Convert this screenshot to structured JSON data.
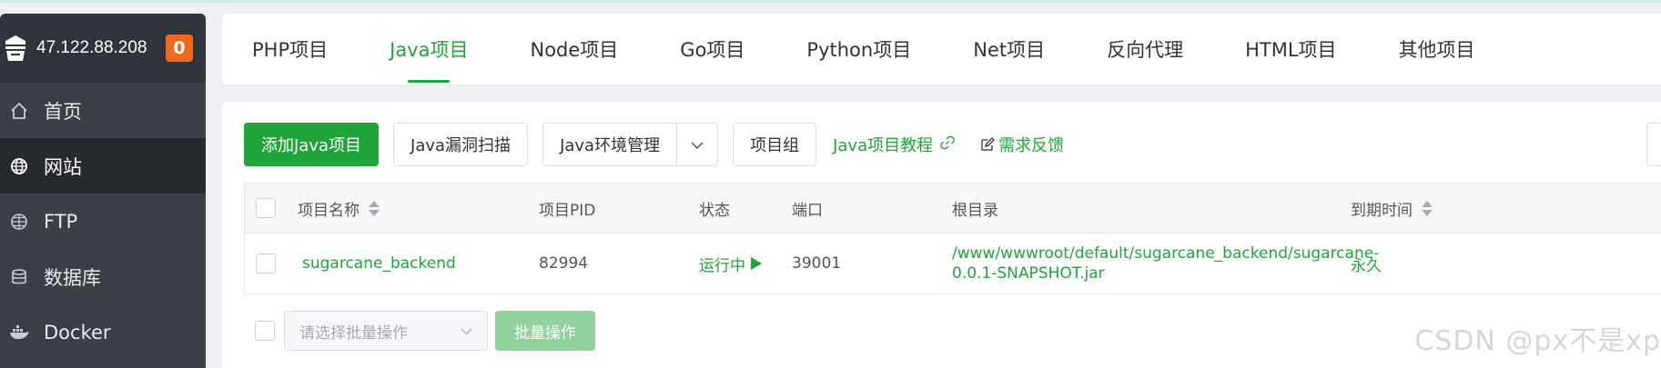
{
  "sidebar": {
    "server_ip": "47.122.88.208",
    "notice_count": "0",
    "items": [
      {
        "label": "首页",
        "icon": "home-icon"
      },
      {
        "label": "网站",
        "icon": "globe-icon"
      },
      {
        "label": "FTP",
        "icon": "ftp-globe-icon"
      },
      {
        "label": "数据库",
        "icon": "database-icon"
      },
      {
        "label": "Docker",
        "icon": "docker-icon"
      }
    ]
  },
  "tabs": [
    {
      "label": "PHP项目"
    },
    {
      "label": "Java项目"
    },
    {
      "label": "Node项目"
    },
    {
      "label": "Go项目"
    },
    {
      "label": "Python项目"
    },
    {
      "label": "Net项目"
    },
    {
      "label": "反向代理"
    },
    {
      "label": "HTML项目"
    },
    {
      "label": "其他项目"
    }
  ],
  "active_tab": "Java项目",
  "toolbar": {
    "add_label": "添加Java项目",
    "scan_label": "Java漏洞扫描",
    "env_label": "Java环境管理",
    "group_label": "项目组",
    "tutorial_label": "Java项目教程",
    "feedback_label": "需求反馈"
  },
  "table": {
    "columns": {
      "name": "项目名称",
      "pid": "项目PID",
      "status": "状态",
      "port": "端口",
      "root": "根目录",
      "expire": "到期时间"
    },
    "rows": [
      {
        "name": "sugarcane_backend",
        "pid": "82994",
        "status": "运行中",
        "port": "39001",
        "root_line1": "/www/wwwroot/default/sugarcane_backend/sugarcane-",
        "root_line2": "0.0.1-SNAPSHOT.jar",
        "expire": "永久"
      }
    ]
  },
  "batch": {
    "placeholder": "请选择批量操作",
    "button_label": "批量操作"
  },
  "watermark": "CSDN @px不是xp",
  "colors": {
    "accent": "#20a53a",
    "sidebar_bg": "#3b4047",
    "badge": "#f06a1e"
  }
}
